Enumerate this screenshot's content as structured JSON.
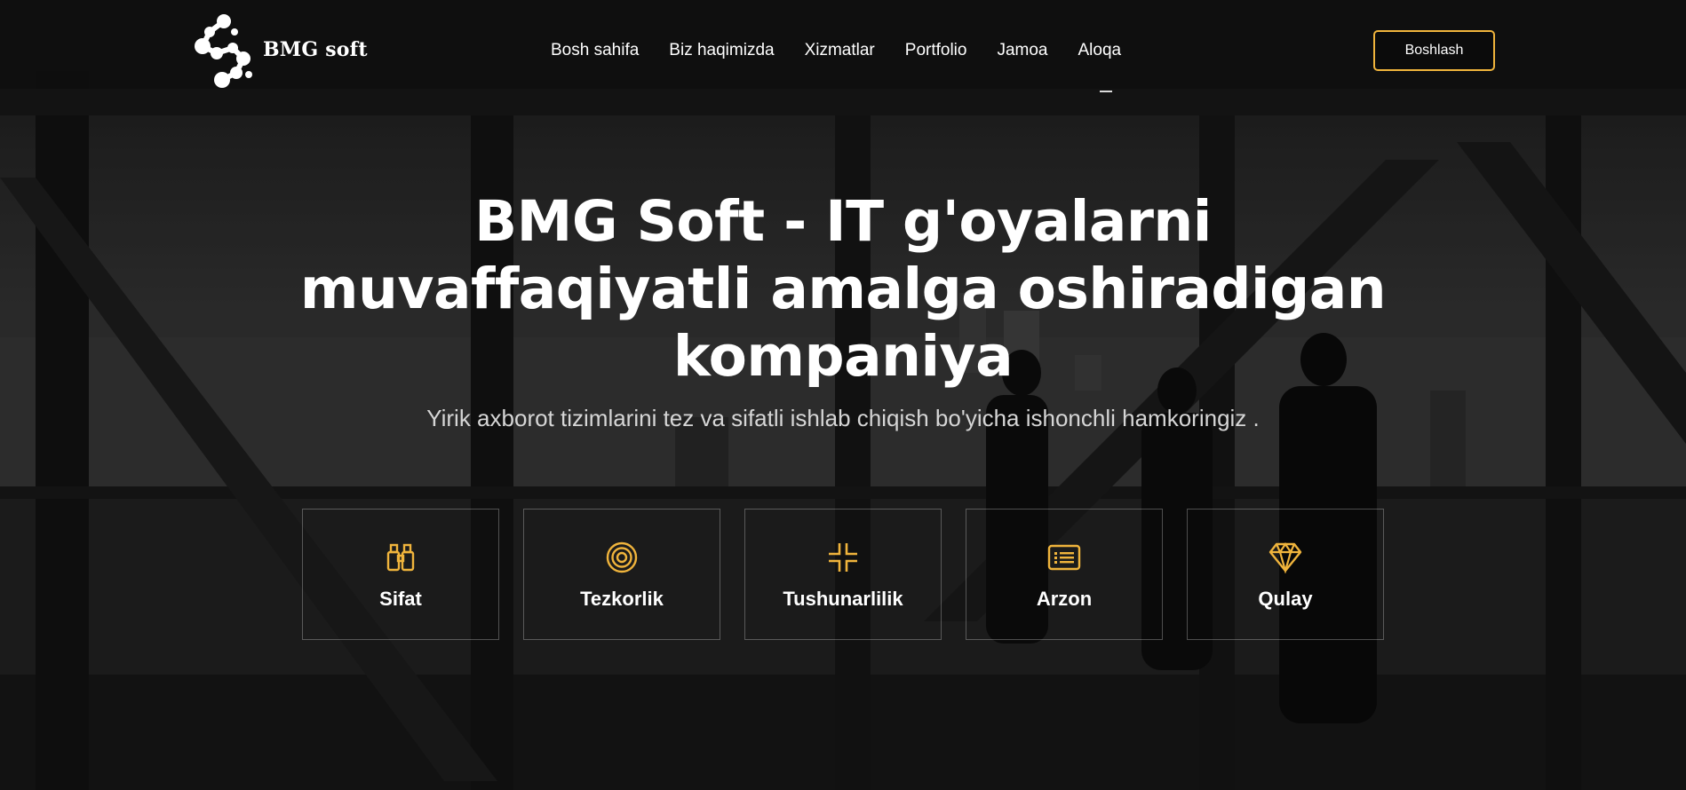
{
  "brand": {
    "name": "BMG soft",
    "accent": "#f0b43c"
  },
  "nav": {
    "items": [
      {
        "label": "Bosh sahifa"
      },
      {
        "label": "Biz haqimizda"
      },
      {
        "label": "Xizmatlar"
      },
      {
        "label": "Portfolio"
      },
      {
        "label": "Jamoa"
      },
      {
        "label": "Aloqa"
      }
    ],
    "cta_label": "Boshlash"
  },
  "hero": {
    "title_line1": "BMG Soft - IT g'oyalarni",
    "title_line2": "muvaffaqiyatli amalga oshiradigan",
    "title_line3": "kompaniya",
    "subtitle": "Yirik axborot tizimlarini tez va sifatli ishlab chiqish bo'yicha ishonchli hamkoringiz ."
  },
  "features": [
    {
      "label": "Sifat",
      "icon": "binoculars-icon"
    },
    {
      "label": "Tezkorlik",
      "icon": "target-icon"
    },
    {
      "label": "Tushunarlilik",
      "icon": "arrows-inward-icon"
    },
    {
      "label": "Arzon",
      "icon": "list-card-icon"
    },
    {
      "label": "Qulay",
      "icon": "diamond-icon"
    }
  ]
}
